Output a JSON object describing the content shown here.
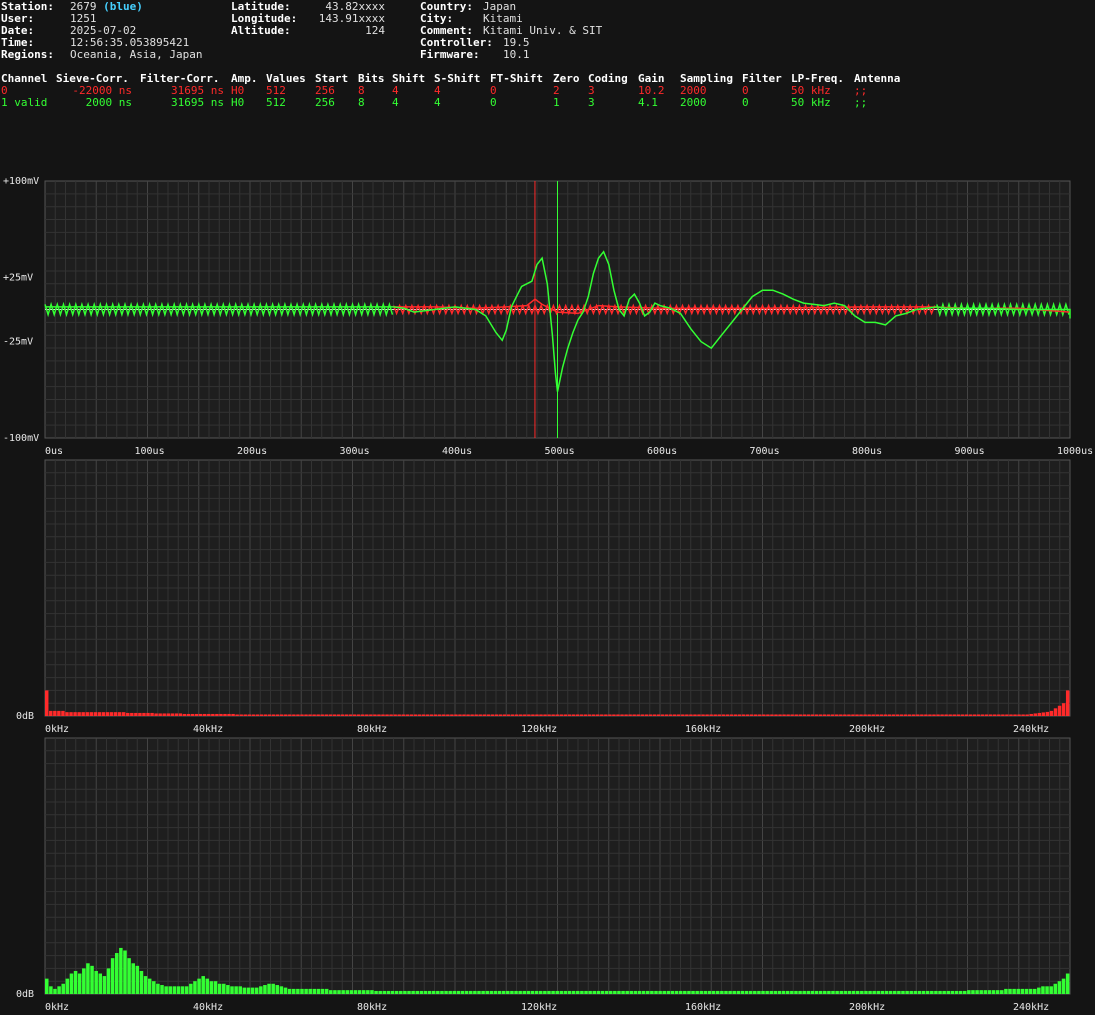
{
  "header": {
    "station_label": "Station:",
    "station": "2679",
    "station_tag": "(blue)",
    "user_label": "User:",
    "user": "1251",
    "date_label": "Date:",
    "date": "2025-07-02",
    "time_label": "Time:",
    "time": "12:56:35.053895421",
    "regions_label": "Regions:",
    "regions": "Oceania, Asia, Japan",
    "latitude_label": "Latitude:",
    "latitude": "43.82xxxx",
    "longitude_label": "Longitude:",
    "longitude": "143.91xxxx",
    "altitude_label": "Altitude:",
    "altitude": "124",
    "country_label": "Country:",
    "country": "Japan",
    "city_label": "City:",
    "city": "Kitami",
    "comment_label": "Comment:",
    "comment": "Kitami Univ. & SIT",
    "controller_label": "Controller:",
    "controller": "19.5",
    "firmware_label": "Firmware:",
    "firmware": "10.1"
  },
  "channels": {
    "headers": [
      "Channel",
      "Sieve-Corr.",
      "Filter-Corr.",
      "Amp.",
      "Values",
      "Start",
      "Bits",
      "Shift",
      "S-Shift",
      "FT-Shift",
      "Zero",
      "Coding",
      "Gain",
      "Sampling",
      "Filter",
      "LP-Freq.",
      "Antenna"
    ],
    "rows": [
      {
        "color": "#ff2a2a",
        "cells": [
          "0",
          "-22000 ns",
          "31695 ns",
          "H0",
          "512",
          "256",
          "8",
          "4",
          "4",
          "0",
          "2",
          "3",
          "10.2",
          "2000",
          "0",
          "50 kHz",
          ";;"
        ]
      },
      {
        "color": "#33ff33",
        "cells": [
          "1 valid",
          "2000 ns",
          "31695 ns",
          "H0",
          "512",
          "256",
          "8",
          "4",
          "4",
          "0",
          "1",
          "3",
          "4.1",
          "2000",
          "0",
          "50 kHz",
          ";;"
        ]
      }
    ]
  },
  "chart_data": [
    {
      "type": "line",
      "x_ticks": [
        "0us",
        "100us",
        "200us",
        "300us",
        "400us",
        "500us",
        "600us",
        "700us",
        "800us",
        "900us",
        "1000us"
      ],
      "y_ticks": [
        "+100mV",
        "+25mV",
        "-25mV",
        "-100mV"
      ],
      "xlim": [
        0,
        1000
      ],
      "ylim": [
        -100,
        100
      ],
      "markers": [
        {
          "x": 478,
          "color": "#ff2a2a"
        },
        {
          "x": 500,
          "color": "#33ff33"
        }
      ],
      "series": [
        {
          "color": "#ff2a2a",
          "x": [
            340,
            380,
            420,
            450,
            470,
            478,
            485,
            500,
            520,
            540,
            560,
            600,
            700,
            800,
            860,
            900,
            950,
            1000
          ],
          "y": [
            2,
            2,
            1,
            2,
            3,
            8,
            4,
            -2,
            -3,
            3,
            2,
            1,
            1,
            2,
            2,
            1,
            1,
            -2
          ]
        },
        {
          "color": "#33ff33",
          "x": [
            0,
            340,
            350,
            360,
            380,
            400,
            410,
            420,
            430,
            440,
            446,
            450,
            455,
            460,
            465,
            470,
            475,
            480,
            485,
            490,
            495,
            498,
            500,
            505,
            510,
            515,
            520,
            525,
            530,
            535,
            540,
            545,
            550,
            555,
            560,
            565,
            570,
            575,
            580,
            585,
            590,
            595,
            600,
            605,
            610,
            620,
            630,
            640,
            650,
            660,
            670,
            680,
            690,
            700,
            710,
            720,
            730,
            740,
            750,
            760,
            770,
            780,
            790,
            800,
            810,
            820,
            830,
            840,
            850,
            860,
            870,
            880,
            900,
            920,
            950,
            1000,
            1010,
            1020
          ],
          "y": [
            2,
            2,
            1,
            -2,
            0,
            2,
            1,
            0,
            -5,
            -18,
            -24,
            -16,
            2,
            10,
            18,
            20,
            22,
            35,
            40,
            20,
            -20,
            -50,
            -64,
            -45,
            -30,
            -18,
            -8,
            -2,
            10,
            28,
            40,
            45,
            35,
            15,
            0,
            -5,
            8,
            12,
            5,
            -5,
            -2,
            5,
            3,
            2,
            1,
            -3,
            -15,
            -25,
            -30,
            -20,
            -10,
            0,
            10,
            15,
            15,
            12,
            8,
            5,
            4,
            3,
            5,
            3,
            -5,
            -10,
            -10,
            -12,
            -5,
            -3,
            0,
            1,
            2,
            1,
            1,
            1,
            0,
            0,
            -4,
            -7
          ]
        }
      ]
    },
    {
      "type": "bar",
      "x_ticks": [
        "0kHz",
        "40kHz",
        "80kHz",
        "120kHz",
        "160kHz",
        "200kHz",
        "240kHz"
      ],
      "y_ticks": [
        "0dB"
      ],
      "xlim": [
        0,
        250
      ],
      "ylim": [
        0,
        100
      ],
      "series": [
        {
          "color": "#ff2a2a",
          "values": [
            10,
            2,
            2,
            2,
            2,
            1.5,
            1.5,
            1.5,
            1.5,
            1.5,
            1.5,
            1.5,
            1.5,
            1.5,
            1.5,
            1.5,
            1.5,
            1.5,
            1.5,
            1.5,
            1.2,
            1.2,
            1.2,
            1.2,
            1.2,
            1.2,
            1.2,
            1.0,
            1.0,
            1.0,
            1.0,
            1.0,
            1.0,
            1.0,
            0.8,
            0.8,
            0.8,
            0.8,
            0.8,
            0.8,
            0.8,
            0.8,
            0.8,
            0.8,
            0.8,
            0.8,
            0.8,
            0.6,
            0.6,
            0.6,
            0.6,
            0.6,
            0.6,
            0.6,
            0.6,
            0.6,
            0.6,
            0.6,
            0.6,
            0.6,
            0.6,
            0.6,
            0.6,
            0.6,
            0.6,
            0.6,
            0.6,
            0.6,
            0.6,
            0.6,
            0.6,
            0.6,
            0.6,
            0.6,
            0.6,
            0.6,
            0.6,
            0.6,
            0.6,
            0.6,
            0.6,
            0.6,
            0.6,
            0.6,
            0.6,
            0.6,
            0.6,
            0.6,
            0.6,
            0.6,
            0.6,
            0.6,
            0.6,
            0.6,
            0.6,
            0.6,
            0.6,
            0.6,
            0.6,
            0.6,
            0.6,
            0.6,
            0.6,
            0.6,
            0.6,
            0.6,
            0.6,
            0.6,
            0.6,
            0.6,
            0.6,
            0.6,
            0.6,
            0.6,
            0.6,
            0.6,
            0.6,
            0.6,
            0.6,
            0.6,
            0.6,
            0.6,
            0.6,
            0.6,
            0.6,
            0.6,
            0.6,
            0.6,
            0.6,
            0.6,
            0.6,
            0.6,
            0.6,
            0.6,
            0.6,
            0.6,
            0.6,
            0.6,
            0.6,
            0.6,
            0.6,
            0.6,
            0.6,
            0.6,
            0.6,
            0.6,
            0.6,
            0.6,
            0.6,
            0.6,
            0.6,
            0.6,
            0.6,
            0.6,
            0.6,
            0.6,
            0.6,
            0.6,
            0.6,
            0.6,
            0.6,
            0.6,
            0.6,
            0.6,
            0.6,
            0.6,
            0.6,
            0.6,
            0.6,
            0.6,
            0.6,
            0.6,
            0.6,
            0.6,
            0.6,
            0.6,
            0.6,
            0.6,
            0.6,
            0.6,
            0.6,
            0.6,
            0.6,
            0.6,
            0.6,
            0.6,
            0.6,
            0.6,
            0.6,
            0.6,
            0.6,
            0.6,
            0.6,
            0.6,
            0.6,
            0.6,
            0.6,
            0.6,
            0.6,
            0.6,
            0.6,
            0.6,
            0.6,
            0.6,
            0.6,
            0.6,
            0.6,
            0.6,
            0.6,
            0.6,
            0.6,
            0.6,
            0.6,
            0.6,
            0.6,
            0.6,
            0.6,
            0.6,
            0.6,
            0.6,
            0.6,
            0.6,
            0.6,
            0.6,
            0.6,
            0.6,
            0.6,
            0.6,
            0.6,
            0.6,
            0.6,
            0.6,
            0.6,
            0.6,
            0.6,
            0.6,
            0.6,
            0.6,
            0.6,
            0.6,
            0.6,
            0.6,
            0.6,
            0.8,
            1.0,
            1.2,
            1.4,
            1.6,
            2.0,
            3,
            4,
            5,
            10
          ]
        }
      ]
    },
    {
      "type": "bar",
      "x_ticks": [
        "0kHz",
        "40kHz",
        "80kHz",
        "120kHz",
        "160kHz",
        "200kHz",
        "240kHz"
      ],
      "y_ticks": [
        "0dB"
      ],
      "xlim": [
        0,
        250
      ],
      "ylim": [
        0,
        100
      ],
      "series": [
        {
          "color": "#33ff33",
          "values": [
            6,
            3,
            2,
            3,
            4,
            6,
            8,
            9,
            8,
            10,
            12,
            11,
            9,
            8,
            7,
            10,
            14,
            16,
            18,
            17,
            14,
            12,
            11,
            9,
            7,
            6,
            5,
            4,
            3.5,
            3,
            3,
            3,
            3,
            3,
            3,
            4,
            5,
            6,
            7,
            6,
            5,
            5,
            4,
            4,
            3.5,
            3,
            3,
            3,
            2.5,
            2.5,
            2.5,
            2.5,
            3,
            3.5,
            4,
            4,
            3.5,
            3,
            2.5,
            2,
            2,
            2,
            2,
            2,
            2,
            2,
            2,
            2,
            2,
            1.5,
            1.5,
            1.5,
            1.5,
            1.5,
            1.5,
            1.5,
            1.5,
            1.5,
            1.5,
            1.5,
            1.2,
            1.2,
            1.2,
            1.2,
            1.2,
            1.2,
            1.2,
            1.2,
            1.2,
            1.2,
            1.2,
            1.2,
            1.2,
            1.2,
            1.2,
            1.2,
            1.2,
            1.2,
            1.2,
            1.2,
            1.2,
            1.2,
            1.2,
            1.2,
            1.2,
            1.2,
            1.2,
            1.2,
            1.2,
            1.2,
            1.2,
            1.2,
            1.2,
            1.2,
            1.2,
            1.2,
            1.2,
            1.2,
            1.2,
            1.2,
            1.2,
            1.2,
            1.2,
            1.2,
            1.2,
            1.2,
            1.2,
            1.2,
            1.2,
            1.2,
            1.2,
            1.2,
            1.2,
            1.2,
            1.2,
            1.2,
            1.2,
            1.2,
            1.2,
            1.2,
            1.2,
            1.2,
            1.2,
            1.2,
            1.2,
            1.2,
            1.2,
            1.2,
            1.2,
            1.2,
            1.2,
            1.2,
            1.2,
            1.2,
            1.2,
            1.2,
            1.2,
            1.2,
            1.2,
            1.2,
            1.2,
            1.2,
            1.2,
            1.2,
            1.2,
            1.2,
            1.2,
            1.2,
            1.2,
            1.2,
            1.2,
            1.2,
            1.2,
            1.2,
            1.2,
            1.2,
            1.2,
            1.2,
            1.2,
            1.2,
            1.2,
            1.2,
            1.2,
            1.2,
            1.2,
            1.2,
            1.2,
            1.2,
            1.2,
            1.2,
            1.2,
            1.2,
            1.2,
            1.2,
            1.2,
            1.2,
            1.2,
            1.2,
            1.2,
            1.2,
            1.2,
            1.2,
            1.2,
            1.2,
            1.2,
            1.2,
            1.2,
            1.2,
            1.2,
            1.2,
            1.2,
            1.2,
            1.2,
            1.2,
            1.2,
            1.2,
            1.2,
            1.2,
            1.2,
            1.2,
            1.2,
            1.2,
            1.2,
            1.2,
            1.5,
            1.5,
            1.5,
            1.5,
            1.5,
            1.5,
            1.5,
            1.5,
            1.5,
            2,
            2,
            2,
            2,
            2,
            2,
            2,
            2,
            2.5,
            3,
            3,
            3,
            4,
            5,
            6,
            8
          ]
        }
      ]
    }
  ]
}
